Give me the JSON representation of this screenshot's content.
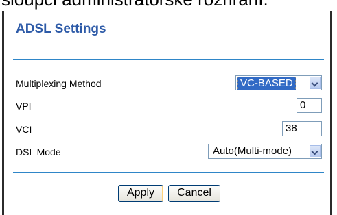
{
  "partial_top_text": "sloupci administrátorské rozhraní:",
  "panel": {
    "title": "ADSL Settings",
    "rows": {
      "multiplexing": {
        "label": "Multiplexing Method",
        "value": "VC-BASED"
      },
      "vpi": {
        "label": "VPI",
        "value": "0"
      },
      "vci": {
        "label": "VCI",
        "value": "38"
      },
      "dsl_mode": {
        "label": "DSL Mode",
        "value": "Auto(Multi-mode)"
      }
    },
    "buttons": {
      "apply": "Apply",
      "cancel": "Cancel"
    }
  },
  "colors": {
    "title": "#2e5ba8",
    "divider": "#2f86c8",
    "selection": "#316ac5"
  },
  "icons": {
    "dropdown": "chevron-down-icon"
  }
}
